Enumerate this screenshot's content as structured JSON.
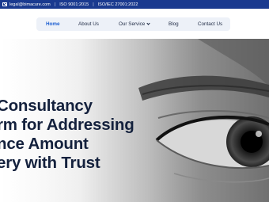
{
  "topbar": {
    "email": "legal@bimacure.com",
    "cert1": "ISO 9001:2015",
    "cert2": "ISO/IEC 27001:2022",
    "bg_color": "#1a3a8f"
  },
  "nav": {
    "items": [
      {
        "label": "Home",
        "active": true
      },
      {
        "label": "About Us"
      },
      {
        "label": "Our Service",
        "has_dropdown": true
      },
      {
        "label": "Blog"
      },
      {
        "label": "Contact Us"
      }
    ],
    "active_color": "#1d5fd1"
  },
  "hero": {
    "lines": [
      "Consultancy",
      "rm for Addressing",
      "nce Amount",
      "ery with Trust"
    ],
    "text_color": "#14213d"
  }
}
